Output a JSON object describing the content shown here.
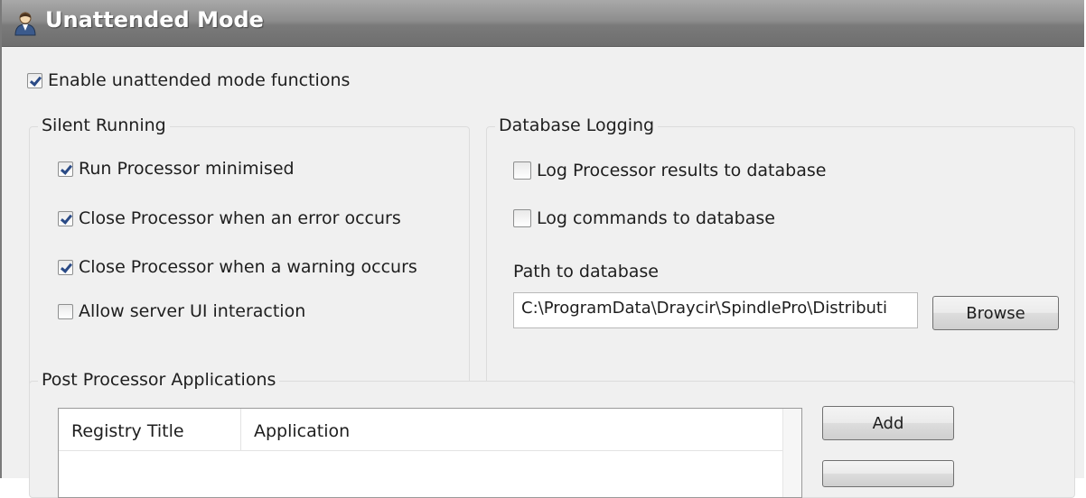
{
  "window": {
    "title": "Unattended Mode",
    "icon": "user-icon"
  },
  "enable_unattended": {
    "label": "Enable unattended mode functions",
    "checked": true
  },
  "silent_running": {
    "title": "Silent Running",
    "options": [
      {
        "label": "Run Processor minimised",
        "checked": true
      },
      {
        "label": "Close Processor when an error occurs",
        "checked": true
      },
      {
        "label": "Close Processor when a warning occurs",
        "checked": true
      },
      {
        "label": "Allow server UI interaction",
        "checked": false
      }
    ]
  },
  "database_logging": {
    "title": "Database Logging",
    "options": [
      {
        "label": "Log Processor results to database",
        "checked": false
      },
      {
        "label": "Log commands to database",
        "checked": false
      }
    ],
    "path_label": "Path to database",
    "path_value": "C:\\ProgramData\\Draycir\\SpindlePro\\Distributi",
    "browse_label": "Browse"
  },
  "post_processor": {
    "title": "Post Processor Applications",
    "columns": [
      "Registry Title",
      "Application"
    ],
    "add_label": "Add"
  },
  "colors": {
    "title_bar": "#8d8d8d",
    "panel": "#f0f0f0",
    "check": "#2a4a86"
  }
}
